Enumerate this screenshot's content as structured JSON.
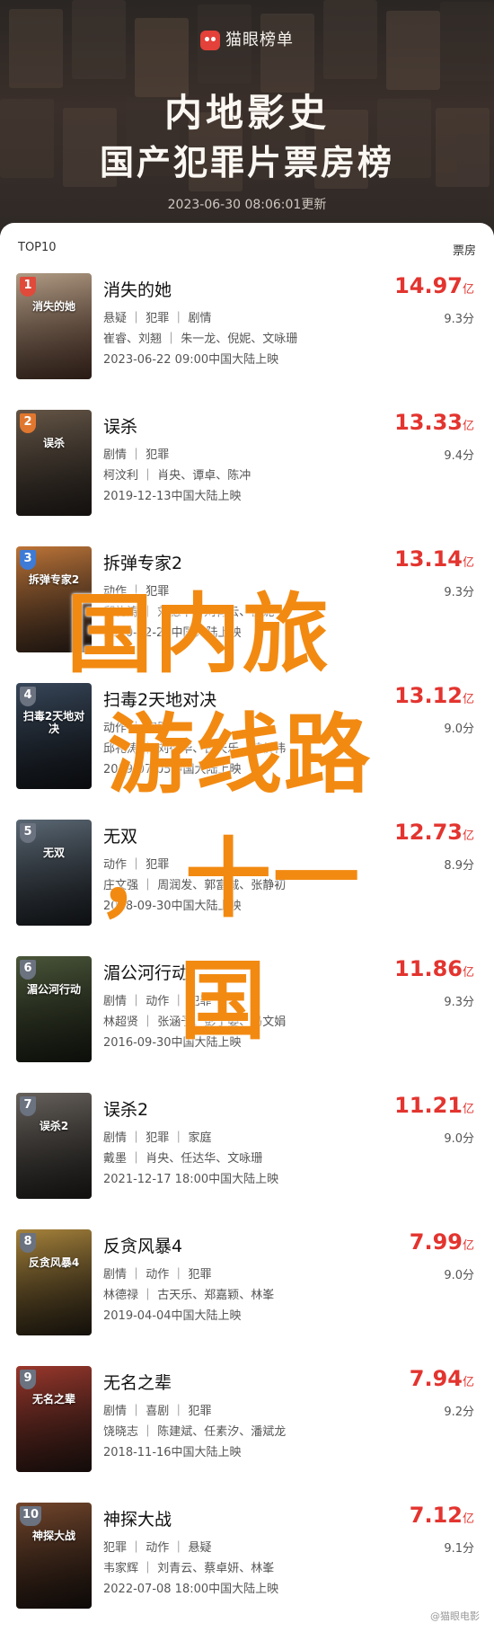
{
  "header": {
    "brand": "猫眼榜单",
    "title_line1": "内地影史",
    "title_line2": "国产犯罪片票房榜",
    "updated": "2023-06-30 08:06:01更新"
  },
  "list": {
    "label_left": "TOP10",
    "label_right": "票房",
    "items": [
      {
        "rank": "1",
        "name": "消失的她",
        "genre": "悬疑 ｜ 犯罪 ｜ 剧情",
        "cast": "崔睿、刘翘 ｜ 朱一龙、倪妮、文咏珊",
        "release": "2023-06-22 09:00中国大陆上映",
        "box": "14.97",
        "unit": "亿",
        "score": "9.3分"
      },
      {
        "rank": "2",
        "name": "误杀",
        "genre": "剧情 ｜ 犯罪",
        "cast": "柯汶利 ｜ 肖央、谭卓、陈冲",
        "release": "2019-12-13中国大陆上映",
        "box": "13.33",
        "unit": "亿",
        "score": "9.4分"
      },
      {
        "rank": "3",
        "name": "拆弹专家2",
        "genre": "动作 ｜ 犯罪",
        "cast": "邱礼涛 ｜ 刘德华、刘青云、倪妮",
        "release": "2020-12-24中国大陆上映",
        "box": "13.14",
        "unit": "亿",
        "score": "9.3分"
      },
      {
        "rank": "4",
        "name": "扫毒2天地对决",
        "genre": "动作 ｜ 犯罪",
        "cast": "邱礼涛 ｜ 刘德华、古天乐、苗侨伟",
        "release": "2019-07-05中国大陆上映",
        "box": "13.12",
        "unit": "亿",
        "score": "9.0分"
      },
      {
        "rank": "5",
        "name": "无双",
        "genre": "动作 ｜ 犯罪",
        "cast": "庄文强 ｜ 周润发、郭富城、张静初",
        "release": "2018-09-30中国大陆上映",
        "box": "12.73",
        "unit": "亿",
        "score": "8.9分"
      },
      {
        "rank": "6",
        "name": "湄公河行动",
        "genre": "剧情 ｜ 动作 ｜ 犯罪",
        "cast": "林超贤 ｜ 张涵予、彭于晏、冯文娟",
        "release": "2016-09-30中国大陆上映",
        "box": "11.86",
        "unit": "亿",
        "score": "9.3分"
      },
      {
        "rank": "7",
        "name": "误杀2",
        "genre": "剧情 ｜ 犯罪 ｜ 家庭",
        "cast": "戴墨 ｜ 肖央、任达华、文咏珊",
        "release": "2021-12-17 18:00中国大陆上映",
        "box": "11.21",
        "unit": "亿",
        "score": "9.0分"
      },
      {
        "rank": "8",
        "name": "反贪风暴4",
        "genre": "剧情 ｜ 动作 ｜ 犯罪",
        "cast": "林德禄 ｜ 古天乐、郑嘉颖、林峯",
        "release": "2019-04-04中国大陆上映",
        "box": "7.99",
        "unit": "亿",
        "score": "9.0分"
      },
      {
        "rank": "9",
        "name": "无名之辈",
        "genre": "剧情 ｜ 喜剧 ｜ 犯罪",
        "cast": "饶晓志 ｜ 陈建斌、任素汐、潘斌龙",
        "release": "2018-11-16中国大陆上映",
        "box": "7.94",
        "unit": "亿",
        "score": "9.2分"
      },
      {
        "rank": "10",
        "name": "神探大战",
        "genre": "犯罪 ｜ 动作 ｜ 悬疑",
        "cast": "韦家辉 ｜ 刘青云、蔡卓妍、林峯",
        "release": "2022-07-08 18:00中国大陆上映",
        "box": "7.12",
        "unit": "亿",
        "score": "9.1分"
      }
    ]
  },
  "overlay": {
    "line1": "国内旅",
    "line2": "游线路",
    "line3": "，十一",
    "line4": "国"
  },
  "watermark": "@猫眼电影",
  "colors": {
    "box_office": "#e3342f",
    "overlay": "#f28a12",
    "brand": "#e3413a"
  }
}
